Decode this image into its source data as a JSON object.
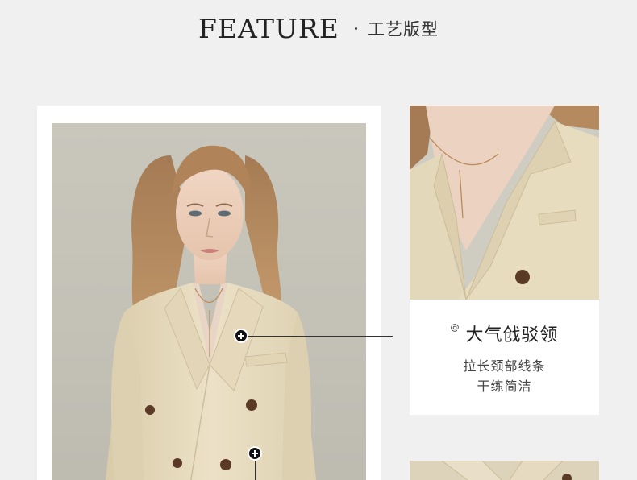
{
  "header": {
    "title_en": "FEATURE",
    "title_cn": "工艺版型"
  },
  "detail": {
    "at_symbol": "@",
    "title": "大气戗驳领",
    "desc_line1": "拉长颈部线条",
    "desc_line2": "干练简洁"
  },
  "hotspots": {
    "icon": "plus-circle-icon"
  },
  "colors": {
    "background": "#f0f0f0",
    "card": "#ffffff",
    "blazer": "#e8dcc0",
    "text": "#222222"
  }
}
